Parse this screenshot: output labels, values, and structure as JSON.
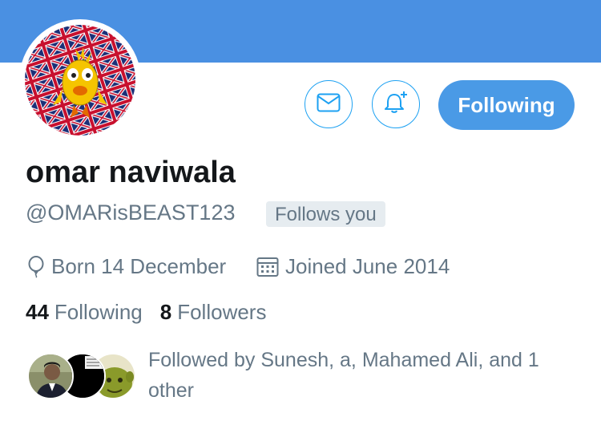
{
  "profile": {
    "name": "omar naviwala",
    "handle": "@OMARisBEAST123",
    "follows_you_badge": "Follows you",
    "born": "Born 14 December",
    "joined": "Joined June 2014"
  },
  "actions": {
    "follow_label": "Following",
    "message_icon": "envelope-icon",
    "notify_icon": "bell-plus-icon"
  },
  "stats": {
    "following_count": "44",
    "following_label": "Following",
    "followers_count": "8",
    "followers_label": "Followers"
  },
  "followed_by": {
    "text": "Followed by Sunesh, a, Mahamed Ali, and 1 other"
  },
  "colors": {
    "banner": "#4a90e2",
    "accent": "#1da1f2",
    "follow_button": "#4a9ae6",
    "secondary_text": "#657786"
  }
}
